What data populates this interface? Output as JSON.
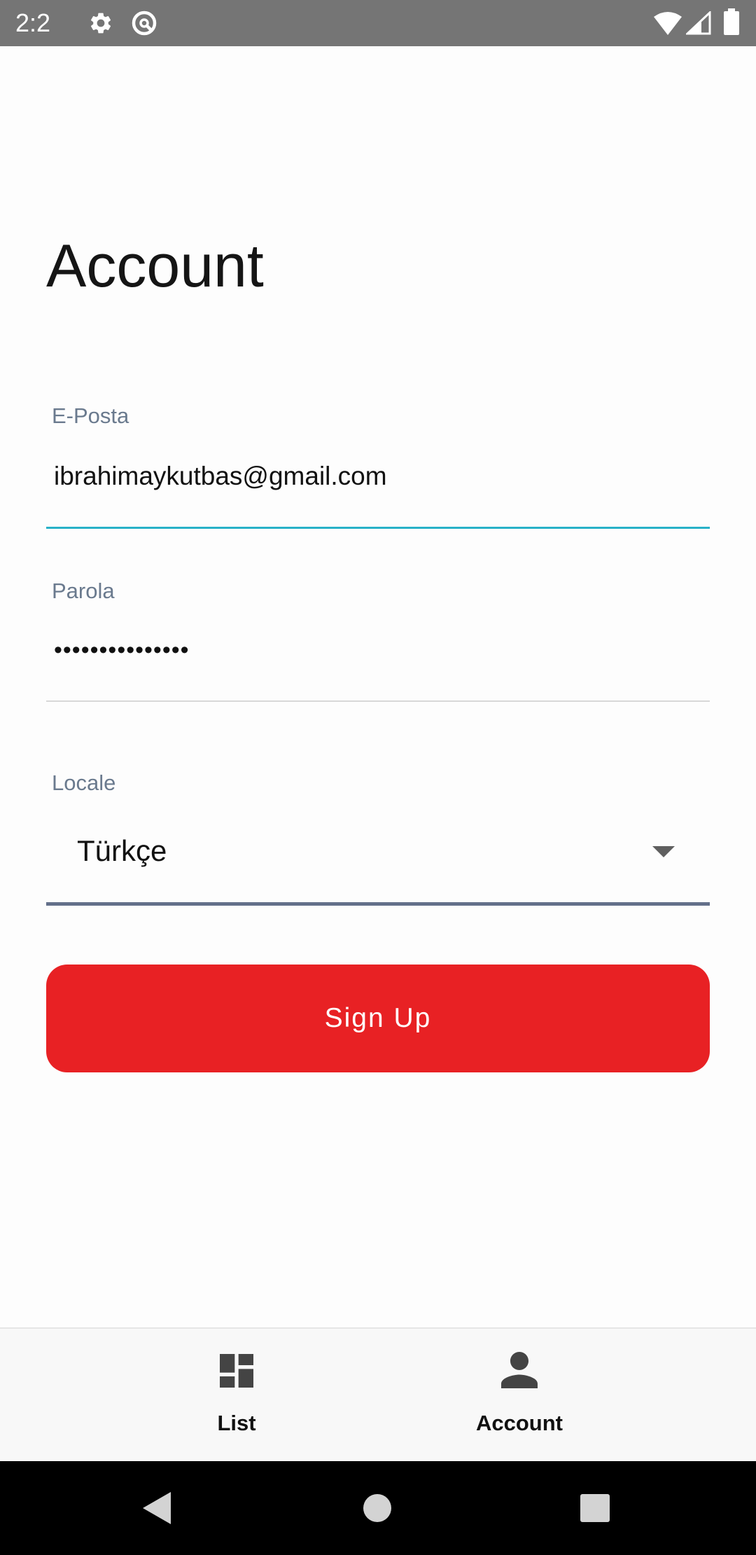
{
  "status_bar": {
    "time": "2:2",
    "left_icons": [
      "gear-icon",
      "no-sync-icon"
    ],
    "right_icons": [
      "wifi-icon",
      "signal-icon",
      "battery-icon"
    ],
    "background": "#757575"
  },
  "page": {
    "title": "Account"
  },
  "form": {
    "email": {
      "label": "E-Posta",
      "value": "ibrahimaykutbas@gmail.com",
      "focused": true,
      "underline_color": "#28b1c8"
    },
    "password": {
      "label": "Parola",
      "masked_value": "•••••••••••••••",
      "underline_color": "#d8d8d8"
    },
    "locale": {
      "label": "Locale",
      "selected": "Türkçe",
      "icon": "chevron-down-icon",
      "underline_color": "#63708a"
    }
  },
  "sign_up_button": {
    "label": "Sign Up",
    "background": "#e82124"
  },
  "bottom_nav": {
    "items": [
      {
        "label": "List",
        "icon": "dashboard-icon"
      },
      {
        "label": "Account",
        "icon": "person-icon"
      }
    ]
  },
  "system_nav": {
    "buttons": [
      "back-icon",
      "home-icon",
      "recents-icon"
    ]
  }
}
